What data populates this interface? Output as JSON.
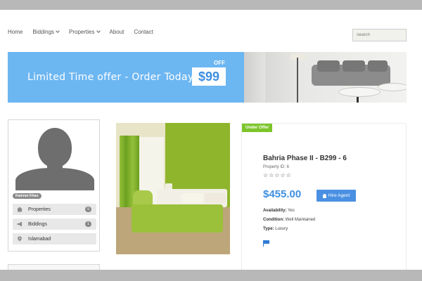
{
  "nav": {
    "items": [
      {
        "label": "Home",
        "dropdown": false
      },
      {
        "label": "Biddings",
        "dropdown": true
      },
      {
        "label": "Properties",
        "dropdown": true
      },
      {
        "label": "About",
        "dropdown": false
      },
      {
        "label": "Contact",
        "dropdown": false
      }
    ],
    "search_placeholder": "Search"
  },
  "banner": {
    "text": "Limited Time offer - Order Today For",
    "off_label": "OFF",
    "price": "$99",
    "colors": {
      "background": "#6cb6f2",
      "price_text": "#3d8fe0"
    }
  },
  "profile": {
    "username": "Kamran Khan",
    "menu": [
      {
        "label": "Properties",
        "icon": "home-icon",
        "count": "5"
      },
      {
        "label": "Biddings",
        "icon": "megaphone-icon",
        "count": "1"
      },
      {
        "label": "Islamabad",
        "icon": "map-pin-icon",
        "count": ""
      }
    ]
  },
  "listing": {
    "badge": "Under Offer",
    "title": "Bahria Phase II - B299 - 6",
    "property_id": "Property ID: 6",
    "rating": {
      "value": 0,
      "max": 5,
      "stars": "☆☆☆☆☆"
    },
    "price": "$455.00",
    "hire_button": "Hire Agent",
    "features": [
      {
        "key": "Availability:",
        "value": "Yes"
      },
      {
        "key": "Condition:",
        "value": "Well Maintained"
      },
      {
        "key": "Type:",
        "value": "Luxury"
      }
    ],
    "colors": {
      "badge": "#7cc52a",
      "price": "#3d8fe0",
      "button": "#4a90e2"
    }
  }
}
